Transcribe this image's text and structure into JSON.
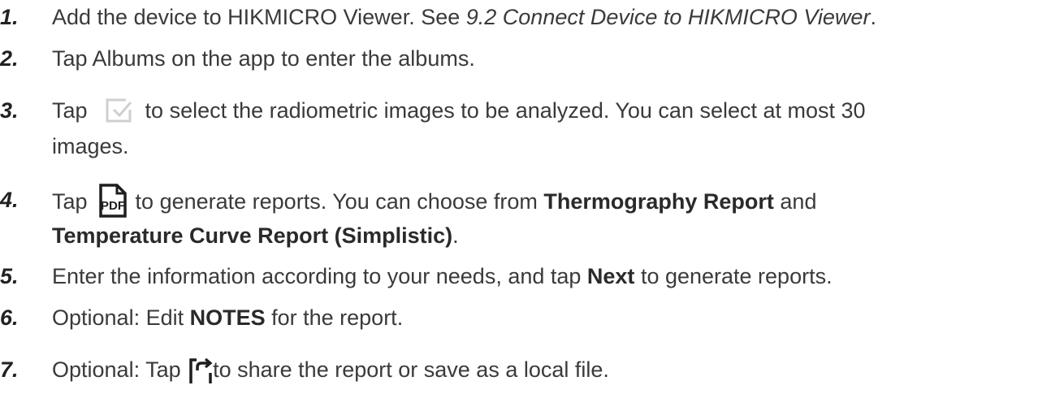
{
  "steps": [
    {
      "num": "1.",
      "pre": "Add the device to HIKMICRO Viewer. See ",
      "ref": "9.2 Connect Device to HIKMICRO Viewer",
      "post": "."
    },
    {
      "num": "2.",
      "text": "Tap Albums on the app to enter the albums."
    },
    {
      "num": "3.",
      "pre": "Tap ",
      "icon": "select-checkbox-icon",
      "post": " to select the radiometric images to be analyzed. You can select at most 30",
      "line2": "images."
    },
    {
      "num": "4.",
      "pre": "Tap ",
      "icon": "pdf-file-icon",
      "icon_text": "PDF",
      "mid": " to generate reports. You can choose from ",
      "b1": "Thermography Report",
      "and": " and",
      "line2_bold": "Temperature Curve Report (Simplistic)",
      "line2_post": "."
    },
    {
      "num": "5.",
      "pre": "Enter the information according to your needs, and tap ",
      "bold": "Next",
      "post": " to generate reports."
    },
    {
      "num": "6.",
      "pre": "Optional: Edit ",
      "bold": "NOTES",
      "post": " for the report."
    },
    {
      "num": "7.",
      "pre": "Optional: Tap ",
      "icon": "share-icon",
      "post": "to share the report or save as a local file."
    }
  ],
  "colors": {
    "text": "#3a3a3a",
    "checkbox_icon": "#c8c8c8"
  }
}
